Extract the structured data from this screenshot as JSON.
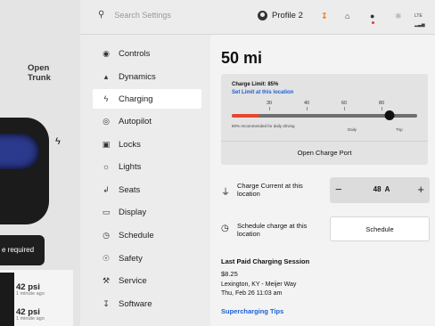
{
  "car_panel": {
    "trunk_line1": "Open",
    "trunk_line2": "Trunk",
    "alert_text": "e required",
    "tires": [
      {
        "pressure": "42 psi",
        "age": "1 minute ago"
      },
      {
        "pressure": "42 psi",
        "age": "1 minute ago"
      }
    ]
  },
  "topbar": {
    "search_placeholder": "Search Settings",
    "profile_label": "Profile 2",
    "lte_label": "LTE"
  },
  "sidebar": {
    "items": [
      {
        "label": "Controls",
        "icon": "toggle-icon"
      },
      {
        "label": "Dynamics",
        "icon": "car-icon"
      },
      {
        "label": "Charging",
        "icon": "bolt-icon",
        "active": true
      },
      {
        "label": "Autopilot",
        "icon": "steering-wheel-icon"
      },
      {
        "label": "Locks",
        "icon": "lock-icon"
      },
      {
        "label": "Lights",
        "icon": "sun-icon"
      },
      {
        "label": "Seats",
        "icon": "seat-icon"
      },
      {
        "label": "Display",
        "icon": "display-icon"
      },
      {
        "label": "Schedule",
        "icon": "clock-icon"
      },
      {
        "label": "Safety",
        "icon": "shield-icon"
      },
      {
        "label": "Service",
        "icon": "wrench-icon"
      },
      {
        "label": "Software",
        "icon": "download-icon"
      }
    ]
  },
  "main": {
    "range": "50 mi",
    "charge_limit_label": "Charge Limit: 85%",
    "set_limit_link": "Set Limit at this location",
    "charge_limit_percent": 85,
    "current_charge_percent": 15,
    "ticks": [
      "30",
      "40",
      "60",
      "80"
    ],
    "recommend_text": "80% recommended for daily driving",
    "daily_label": "Daily",
    "trip_label": "Trip",
    "open_port_label": "Open Charge Port",
    "charge_current_label": "Charge Current at this location",
    "charge_current_value": "48",
    "charge_current_unit": "A",
    "schedule_label": "Schedule charge at this location",
    "schedule_button": "Schedule",
    "last_session_title": "Last Paid Charging Session",
    "last_session_amount": "$8.25",
    "last_session_location": "Lexington, KY - Meijer Way",
    "last_session_date": "Thu, Feb 26 11:03 am",
    "supercharging_tips": "Supercharging Tips"
  },
  "colors": {
    "accent_blue": "#1d5fd6",
    "charge_red": "#e4472e",
    "download_orange": "#e8740c",
    "notification_red": "#e33b2e"
  }
}
